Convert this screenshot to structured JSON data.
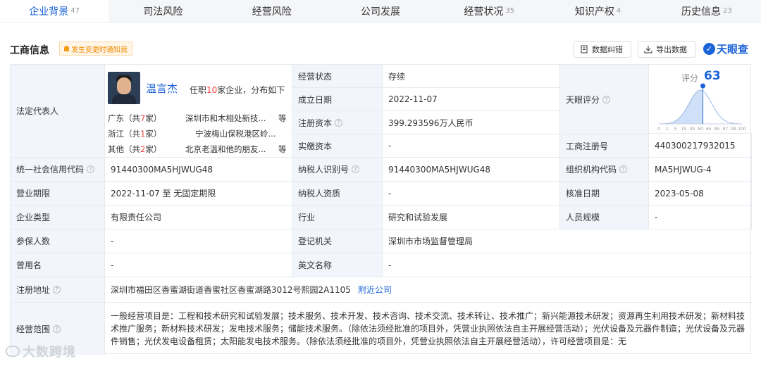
{
  "tabs": [
    {
      "label": "企业背景",
      "count": "47"
    },
    {
      "label": "司法风险",
      "count": ""
    },
    {
      "label": "经营风险",
      "count": ""
    },
    {
      "label": "公司发展",
      "count": ""
    },
    {
      "label": "经营状况",
      "count": "35"
    },
    {
      "label": "知识产权",
      "count": "4"
    },
    {
      "label": "历史信息",
      "count": "23"
    }
  ],
  "header": {
    "title": "工商信息",
    "notify_label": "发生变更时通知我",
    "correct_label": "数据纠错",
    "export_label": "导出数据",
    "logo_text": "天眼查"
  },
  "rep": {
    "label": "法定代表人",
    "name": "温言杰",
    "summary_pre": "任职",
    "summary_num": "10",
    "summary_post": "家企业，分布如下",
    "lines": [
      {
        "region": "广东（共",
        "count": "7",
        "suffix": "家）",
        "company": "深圳市和木相处新技...",
        "more": "等"
      },
      {
        "region": "浙江（共",
        "count": "1",
        "suffix": "家）",
        "company": "宁波梅山保税港区岭...",
        "more": ""
      },
      {
        "region": "其他（共",
        "count": "2",
        "suffix": "家）",
        "company": "北京老温和他的朋友...",
        "more": "等"
      }
    ]
  },
  "fields": {
    "status_label": "经营状态",
    "status_value": "存续",
    "est_label": "成立日期",
    "est_value": "2022-11-07",
    "capital_label": "注册资本",
    "capital_value": "399.293596万人民币",
    "paid_label": "实缴资本",
    "paid_value": "-",
    "score_label": "天眼评分",
    "score_small_label": "评分",
    "score_value": "63",
    "regno_label": "工商注册号",
    "regno_value": "440300217932015",
    "credit_label": "统一社会信用代码",
    "credit_value": "91440300MA5HJWUG48",
    "taxid_label": "纳税人识别号",
    "taxid_value": "91440300MA5HJWUG48",
    "orgcode_label": "组织机构代码",
    "orgcode_value": "MA5HJWUG-4",
    "term_label": "营业期限",
    "term_value": "2022-11-07 至 无固定期限",
    "taxq_label": "纳税人资质",
    "taxq_value": "-",
    "approve_label": "核准日期",
    "approve_value": "2023-05-08",
    "type_label": "企业类型",
    "type_value": "有限责任公司",
    "industry_label": "行业",
    "industry_value": "研究和试验发展",
    "staff_label": "人员规模",
    "staff_value": "-",
    "insured_label": "参保人数",
    "insured_value": "-",
    "authority_label": "登记机关",
    "authority_value": "深圳市市场监督管理局",
    "former_label": "曾用名",
    "former_value": "-",
    "en_label": "英文名称",
    "en_value": "-",
    "addr_label": "注册地址",
    "addr_value": "深圳市福田区香蜜湖街道香蜜社区香蜜湖路3012号熙园2A1105",
    "addr_link": "附近公司",
    "scope_label": "经营范围",
    "scope_value": "一般经营项目是：工程和技术研究和试验发展；技术服务、技术开发、技术咨询、技术交流、技术转让、技术推广；新兴能源技术研发；资源再生利用技术研发；新材料技术推广服务；新材料技术研发；发电技术服务；储能技术服务。（除依法须经批准的项目外，凭营业执照依法自主开展经营活动）；光伏设备及元器件制造；光伏设备及元器件销售；光伏发电设备租赁；太阳能发电技术服务。（除依法须经批准的项目外，凭营业执照依法自主开展经营活动），许可经营项目是：无"
  },
  "score_chart": {
    "ticks": [
      "0",
      "1",
      "5",
      "15",
      "30",
      "50",
      "65",
      "85",
      "97",
      "99",
      "100"
    ],
    "value": 63
  },
  "watermark": "大数跨境",
  "colors": {
    "accent": "#1b63d8",
    "label_bg": "#f2f6fc",
    "highlight": "#f04040",
    "notify": "#f08a00"
  }
}
